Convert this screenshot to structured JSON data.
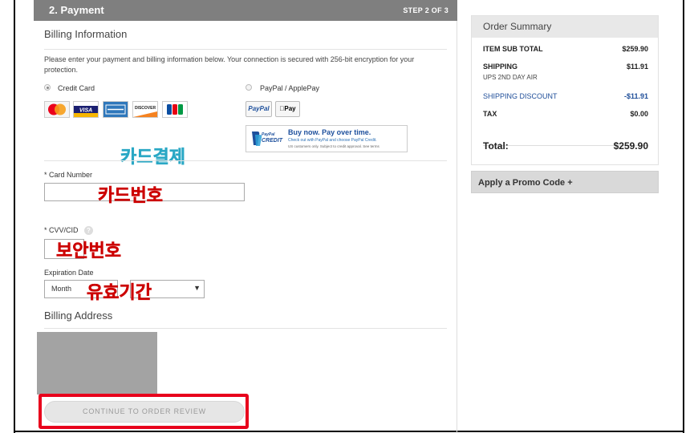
{
  "header": {
    "title": "2. Payment",
    "step": "STEP 2 OF 3"
  },
  "billing": {
    "title": "Billing Information",
    "intro": "Please enter your payment and billing information below. Your connection is secured with 256-bit encryption for your protection.",
    "credit_card_label": "Credit Card",
    "paypal_label": "PayPal / ApplePay",
    "paypal_button": "PayPal",
    "applepay_button": "Pay",
    "paypal_credit_logo": "PayPal CREDIT",
    "paypal_credit_headline": "Buy now. Pay over time.",
    "paypal_credit_sub": "Check out with PayPal and choose PayPal Credit.",
    "paypal_credit_fine": "US customers only. Subject to credit approval. See terms",
    "card_logos": [
      "MasterCard",
      "VISA",
      "AMERICAN EXPRESS",
      "DISCOVER",
      "JCB"
    ]
  },
  "fields": {
    "card_number_label": "* Card Number",
    "cvv_label": "* CVV/CID",
    "cvv_help": "?",
    "expiration_label": "Expiration Date",
    "month_value": "Month",
    "year_caret": "▼"
  },
  "billing_address": {
    "title": "Billing Address"
  },
  "continue_button": "CONTINUE TO ORDER REVIEW",
  "overlays": {
    "card_payment": "카드결제",
    "card_number": "카드번호",
    "security_code": "보안번호",
    "validity_period": "유효기간"
  },
  "order_summary": {
    "title": "Order Summary",
    "item_subtotal_label": "ITEM SUB TOTAL",
    "item_subtotal": "$259.90",
    "shipping_label": "SHIPPING",
    "shipping_method": "UPS 2ND DAY AIR",
    "shipping": "$11.91",
    "shipping_discount_label": "SHIPPING DISCOUNT",
    "shipping_discount": "-$11.91",
    "tax_label": "TAX",
    "tax": "$0.00",
    "total_label": "Total:",
    "total": "$259.90"
  },
  "promo": {
    "label": "Apply a Promo Code +"
  },
  "colors": {
    "header_gray": "#7f7f7f",
    "highlight_red": "#e8001c",
    "discount_blue": "#1f4e99",
    "annotation_red": "#cc0000",
    "annotation_teal": "#2aa8c5"
  }
}
